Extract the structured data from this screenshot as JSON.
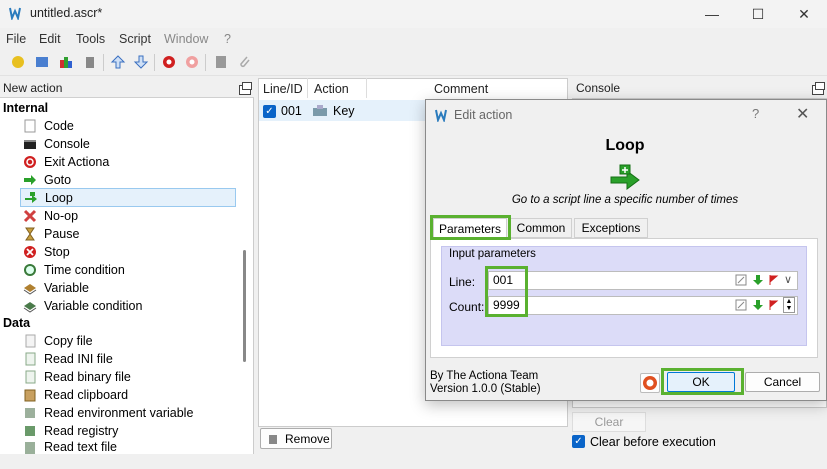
{
  "window": {
    "title": "untitled.ascr*"
  },
  "menu": [
    "File",
    "Edit",
    "Tools",
    "Script",
    "Window",
    "?"
  ],
  "left_panel": {
    "title": "New action",
    "categories": [
      {
        "name": "Internal",
        "items": [
          "Code",
          "Console",
          "Exit Actiona",
          "Goto",
          "Loop",
          "No-op",
          "Pause",
          "Stop",
          "Time condition",
          "Variable",
          "Variable condition"
        ]
      },
      {
        "name": "Data",
        "items": [
          "Copy file",
          "Read INI file",
          "Read binary file",
          "Read clipboard",
          "Read environment variable",
          "Read registry",
          "Read text file"
        ]
      }
    ],
    "selected": "Loop"
  },
  "script_table": {
    "columns": [
      "Line/ID",
      "Action",
      "Comment"
    ],
    "rows": [
      {
        "line": "001",
        "action": "Key",
        "comment": "",
        "enabled": true
      }
    ],
    "remove_label": "Remove"
  },
  "console": {
    "title": "Console",
    "clear_label": "Clear",
    "clear_before_label": "Clear before execution"
  },
  "dialog": {
    "title": "Edit action",
    "help": "?",
    "action_name": "Loop",
    "description": "Go to a script line a specific number of times",
    "tabs": [
      "Parameters",
      "Common",
      "Exceptions"
    ],
    "group_title": "Input parameters",
    "line_label": "Line:",
    "line_value": "001",
    "count_label": "Count:",
    "count_value": "9999",
    "credit_author": "By The Actiona Team",
    "credit_version": "Version 1.0.0 (Stable)",
    "ok": "OK",
    "cancel": "Cancel"
  },
  "colors": {
    "highlight": "#5ab130",
    "selection": "#e5f1fb",
    "accent": "#0078d7"
  }
}
